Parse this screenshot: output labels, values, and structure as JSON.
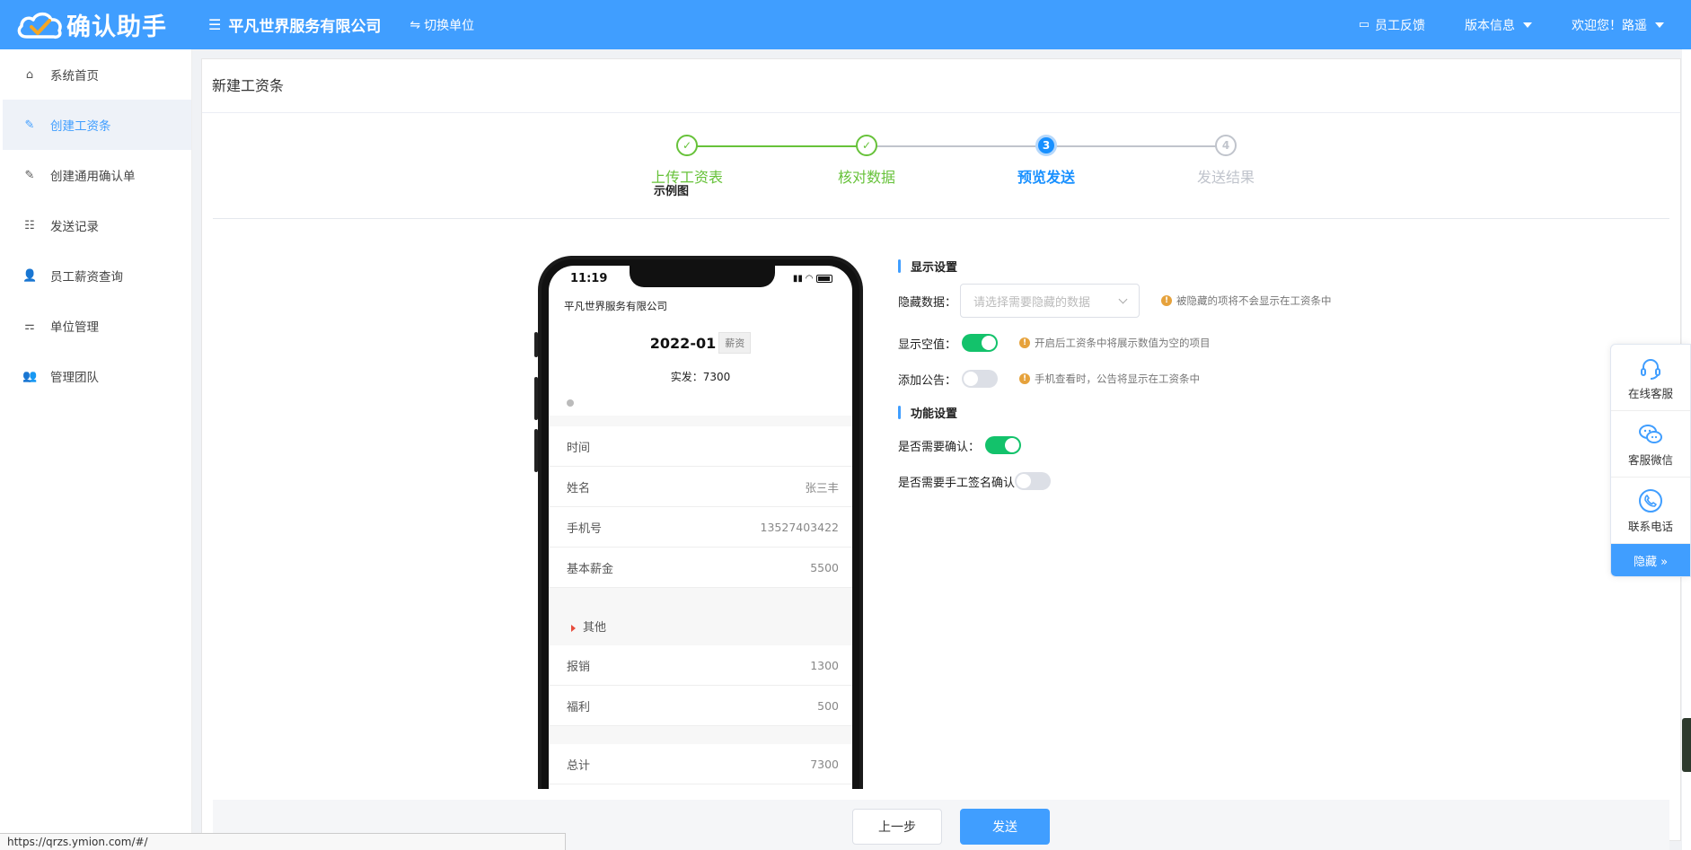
{
  "header": {
    "logo_text": "确认助手",
    "company": "平凡世界服务有限公司",
    "switch_label": "切换单位",
    "feedback": "员工反馈",
    "version": "版本信息",
    "welcome": "欢迎您！路遥"
  },
  "sidebar": {
    "items": [
      {
        "label": "系统首页",
        "icon": "home-icon"
      },
      {
        "label": "创建工资条",
        "icon": "edit-icon"
      },
      {
        "label": "创建通用确认单",
        "icon": "edit-icon"
      },
      {
        "label": "发送记录",
        "icon": "list-icon"
      },
      {
        "label": "员工薪资查询",
        "icon": "user-search-icon"
      },
      {
        "label": "单位管理",
        "icon": "org-icon"
      },
      {
        "label": "管理团队",
        "icon": "team-icon"
      }
    ]
  },
  "page": {
    "title": "新建工资条"
  },
  "steps": [
    {
      "num": "1",
      "label": "上传工资表",
      "state": "done"
    },
    {
      "num": "2",
      "label": "核对数据",
      "state": "done"
    },
    {
      "num": "3",
      "label": "预览发送",
      "state": "current"
    },
    {
      "num": "4",
      "label": "发送结果",
      "state": "wait"
    }
  ],
  "preview": {
    "title": "示例图",
    "time": "11:19",
    "company": "平凡世界服务有限公司",
    "month": "2022-01",
    "tag": "薪资",
    "paid": "实发：7300",
    "rows": [
      {
        "k": "时间",
        "v": ""
      },
      {
        "k": "姓名",
        "v": "张三丰"
      },
      {
        "k": "手机号",
        "v": "13527403422"
      },
      {
        "k": "基本薪金",
        "v": "5500"
      }
    ],
    "section": "其他",
    "rows2": [
      {
        "k": "报销",
        "v": "1300"
      },
      {
        "k": "福利",
        "v": "500"
      }
    ],
    "total": {
      "k": "总计",
      "v": "7300"
    }
  },
  "settings": {
    "display_title": "显示设置",
    "hide_label": "隐藏数据：",
    "hide_placeholder": "请选择需要隐藏的数据",
    "hide_hint": "被隐藏的项将不会显示在工资条中",
    "empty_label": "显示空值：",
    "empty_hint": "开启后工资条中将展示数值为空的项目",
    "empty_on": true,
    "notice_label": "添加公告：",
    "notice_hint": "手机查看时，公告将显示在工资条中",
    "notice_on": false,
    "func_title": "功能设置",
    "confirm_label": "是否需要确认：",
    "confirm_on": true,
    "sign_label": "是否需要手工签名确认",
    "sign_on": false
  },
  "footer": {
    "prev": "上一步",
    "send": "发送"
  },
  "float": {
    "online": "在线客服",
    "wechat": "客服微信",
    "phone": "联系电话",
    "hide": "隐藏 »"
  },
  "status_url": "https://qrzs.ymion.com/#/",
  "colors": {
    "primary": "#409EFF",
    "success": "#67C23A",
    "switch_on": "#13c26b",
    "warning": "#E6A23C"
  }
}
